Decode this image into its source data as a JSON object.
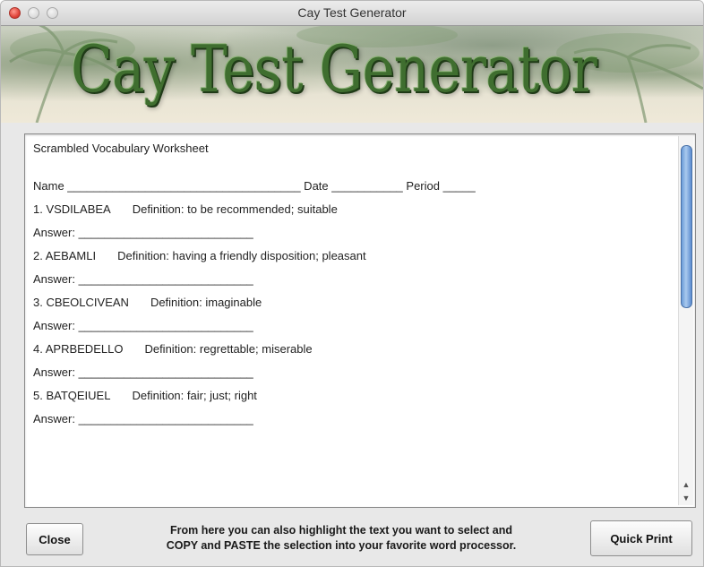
{
  "window": {
    "title": "Cay Test Generator"
  },
  "banner": {
    "logo_text": "Cay Test Generator"
  },
  "worksheet": {
    "heading": "Scrambled Vocabulary Worksheet",
    "name_line": "Name ____________________________________ Date ___________ Period _____",
    "items": [
      {
        "word": "1. VSDILABEA",
        "definition": "Definition:  to be recommended; suitable",
        "answer": "Answer: ___________________________"
      },
      {
        "word": "2. AEBAMLI",
        "definition": "Definition:  having a friendly disposition; pleasant",
        "answer": "Answer: ___________________________"
      },
      {
        "word": "3. CBEOLCIVEAN",
        "definition": "Definition:  imaginable",
        "answer": "Answer: ___________________________"
      },
      {
        "word": "4. APRBEDELLO",
        "definition": "Definition:  regrettable; miserable",
        "answer": "Answer: ___________________________"
      },
      {
        "word": "5. BATQEIUEL",
        "definition": "Definition:  fair; just; right",
        "answer": "Answer: ___________________________"
      }
    ]
  },
  "footer": {
    "close_label": "Close",
    "hint_line1": "From here you can also highlight the text you want to select and",
    "hint_line2": "COPY and PASTE the selection into your favorite word processor.",
    "print_label": "Quick Print"
  }
}
